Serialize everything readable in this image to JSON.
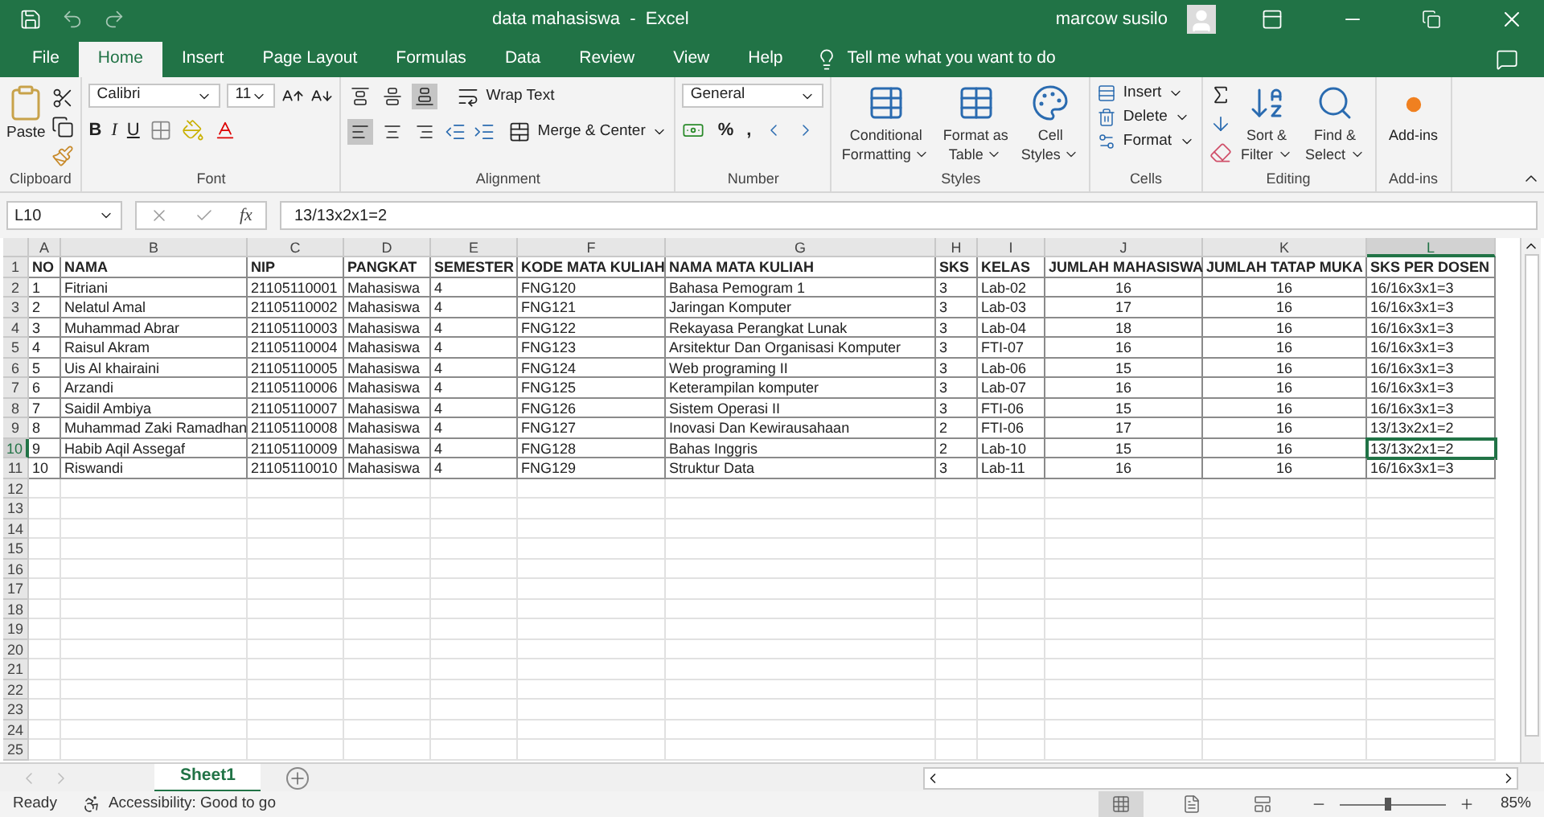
{
  "title_bar": {
    "document_title": "data mahasiswa  -  Excel",
    "user_name": "marcow susilo"
  },
  "ribbon_tabs": [
    {
      "label": "File",
      "selected": false
    },
    {
      "label": "Home",
      "selected": true
    },
    {
      "label": "Insert",
      "selected": false
    },
    {
      "label": "Page Layout",
      "selected": false
    },
    {
      "label": "Formulas",
      "selected": false
    },
    {
      "label": "Data",
      "selected": false
    },
    {
      "label": "Review",
      "selected": false
    },
    {
      "label": "View",
      "selected": false
    },
    {
      "label": "Help",
      "selected": false
    }
  ],
  "tell_me": {
    "placeholder": "Tell me what you want to do"
  },
  "ribbon": {
    "clipboard": {
      "label": "Clipboard",
      "paste": "Paste"
    },
    "font": {
      "label": "Font",
      "font_name": "Calibri",
      "font_size": "11",
      "styles": [
        "B",
        "I",
        "U"
      ]
    },
    "alignment": {
      "label": "Alignment",
      "wrap_text": "Wrap Text",
      "merge_center": "Merge & Center",
      "vertical_align_buttons": [
        {
          "selected": false
        },
        {
          "selected": false
        },
        {
          "selected": true
        }
      ],
      "horizontal_align_buttons": [
        {
          "selected": true
        },
        {
          "selected": false
        },
        {
          "selected": false
        }
      ]
    },
    "number": {
      "label": "Number",
      "format": "General",
      "symbols": [
        "%",
        ","
      ]
    },
    "styles": {
      "label": "Styles",
      "buttons": [
        {
          "lines": [
            "Conditional",
            "Formatting"
          ]
        },
        {
          "lines": [
            "Format as",
            "Table"
          ]
        },
        {
          "lines": [
            "Cell",
            "Styles"
          ]
        }
      ]
    },
    "cells": {
      "label": "Cells",
      "buttons": [
        "Insert",
        "Delete",
        "Format"
      ]
    },
    "editing": {
      "label": "Editing",
      "buttons": [
        {
          "lines": [
            "Sort &",
            "Filter"
          ]
        },
        {
          "lines": [
            "Find &",
            "Select"
          ]
        }
      ]
    },
    "add_ins": {
      "label": "Add-ins",
      "button": "Add-ins"
    }
  },
  "formula_bar": {
    "name_box": "L10",
    "fx": "fx",
    "formula": "13/13x2x1=2"
  },
  "sheet": {
    "columns": [
      {
        "letter": "A",
        "centered": false,
        "selected": false
      },
      {
        "letter": "B",
        "centered": false,
        "selected": false
      },
      {
        "letter": "C",
        "centered": false,
        "selected": false
      },
      {
        "letter": "D",
        "centered": false,
        "selected": false
      },
      {
        "letter": "E",
        "centered": false,
        "selected": false
      },
      {
        "letter": "F",
        "centered": false,
        "selected": false
      },
      {
        "letter": "G",
        "centered": false,
        "selected": false
      },
      {
        "letter": "H",
        "centered": false,
        "selected": false
      },
      {
        "letter": "I",
        "centered": false,
        "selected": false
      },
      {
        "letter": "J",
        "centered": true,
        "selected": false
      },
      {
        "letter": "K",
        "centered": true,
        "selected": false
      },
      {
        "letter": "L",
        "centered": false,
        "selected": true
      }
    ],
    "rows": [
      {
        "number": "1",
        "kind": "header",
        "selected": false,
        "cells": [
          "NO",
          "NAMA",
          "NIP",
          "PANGKAT",
          "SEMESTER",
          "KODE MATA KULIAH",
          "NAMA MATA KULIAH",
          "SKS",
          "KELAS",
          "JUMLAH MAHASISWA",
          "JUMLAH TATAP MUKA",
          "SKS PER DOSEN"
        ]
      },
      {
        "number": "2",
        "kind": "data",
        "selected": false,
        "cells": [
          "1",
          "Fitriani",
          "21105110001",
          "Mahasiswa",
          "4",
          "FNG120",
          "Bahasa Pemogram 1",
          "3",
          "Lab-02",
          "16",
          "16",
          "16/16x3x1=3"
        ]
      },
      {
        "number": "3",
        "kind": "data",
        "selected": false,
        "cells": [
          "2",
          "Nelatul Amal",
          "21105110002",
          "Mahasiswa",
          "4",
          "FNG121",
          "Jaringan Komputer",
          "3",
          "Lab-03",
          "17",
          "16",
          "16/16x3x1=3"
        ]
      },
      {
        "number": "4",
        "kind": "data",
        "selected": false,
        "cells": [
          "3",
          "Muhammad Abrar",
          "21105110003",
          "Mahasiswa",
          "4",
          "FNG122",
          "Rekayasa Perangkat Lunak",
          "3",
          "Lab-04",
          "18",
          "16",
          "16/16x3x1=3"
        ]
      },
      {
        "number": "5",
        "kind": "data",
        "selected": false,
        "cells": [
          "4",
          "Raisul Akram",
          "21105110004",
          "Mahasiswa",
          "4",
          "FNG123",
          "Arsitektur Dan Organisasi Komputer",
          "3",
          "FTI-07",
          "16",
          "16",
          "16/16x3x1=3"
        ]
      },
      {
        "number": "6",
        "kind": "data",
        "selected": false,
        "cells": [
          "5",
          "Uis Al khairaini",
          "21105110005",
          "Mahasiswa",
          "4",
          "FNG124",
          "Web programing II",
          "3",
          "Lab-06",
          "15",
          "16",
          "16/16x3x1=3"
        ]
      },
      {
        "number": "7",
        "kind": "data",
        "selected": false,
        "cells": [
          "6",
          "Arzandi",
          "21105110006",
          "Mahasiswa",
          "4",
          "FNG125",
          "Keterampilan komputer",
          "3",
          "Lab-07",
          "16",
          "16",
          "16/16x3x1=3"
        ]
      },
      {
        "number": "8",
        "kind": "data",
        "selected": false,
        "cells": [
          "7",
          "Saidil Ambiya",
          "21105110007",
          "Mahasiswa",
          "4",
          "FNG126",
          "Sistem Operasi II",
          "3",
          "FTI-06",
          "15",
          "16",
          "16/16x3x1=3"
        ]
      },
      {
        "number": "9",
        "kind": "data",
        "selected": false,
        "cells": [
          "8",
          "Muhammad Zaki Ramadhan",
          "21105110008",
          "Mahasiswa",
          "4",
          "FNG127",
          "Inovasi Dan Kewirausahaan",
          "2",
          "FTI-06",
          "17",
          "16",
          "13/13x2x1=2"
        ]
      },
      {
        "number": "10",
        "kind": "data",
        "selected": true,
        "cells": [
          "9",
          "Habib Aqil Assegaf",
          "21105110009",
          "Mahasiswa",
          "4",
          "FNG128",
          "Bahas Inggris",
          "2",
          "Lab-10",
          "15",
          "16",
          "13/13x2x1=2"
        ]
      },
      {
        "number": "11",
        "kind": "data",
        "selected": false,
        "cells": [
          "10",
          "Riswandi",
          "21105110010",
          "Mahasiswa",
          "4",
          "FNG129",
          "Struktur Data",
          "3",
          "Lab-11",
          "16",
          "16",
          "16/16x3x1=3"
        ]
      },
      {
        "number": "12",
        "kind": "empty",
        "selected": false
      },
      {
        "number": "13",
        "kind": "empty",
        "selected": false
      },
      {
        "number": "14",
        "kind": "empty",
        "selected": false
      },
      {
        "number": "15",
        "kind": "empty",
        "selected": false
      },
      {
        "number": "16",
        "kind": "empty",
        "selected": false
      },
      {
        "number": "17",
        "kind": "empty",
        "selected": false
      },
      {
        "number": "18",
        "kind": "empty",
        "selected": false
      },
      {
        "number": "19",
        "kind": "empty",
        "selected": false
      },
      {
        "number": "20",
        "kind": "empty",
        "selected": false
      },
      {
        "number": "21",
        "kind": "empty",
        "selected": false
      },
      {
        "number": "22",
        "kind": "empty",
        "selected": false
      },
      {
        "number": "23",
        "kind": "empty",
        "selected": false
      },
      {
        "number": "24",
        "kind": "empty",
        "selected": false
      },
      {
        "number": "25",
        "kind": "empty",
        "selected": false
      }
    ]
  },
  "sheet_tabs": [
    {
      "label": "Sheet1",
      "selected": true
    }
  ],
  "status_bar": {
    "mode": "Ready",
    "accessibility": "Accessibility: Good to go",
    "view_buttons": [
      {
        "selected": true
      },
      {
        "selected": false
      },
      {
        "selected": false
      }
    ],
    "zoom_slider": {
      "level": 0.46
    },
    "zoom": "85%"
  }
}
